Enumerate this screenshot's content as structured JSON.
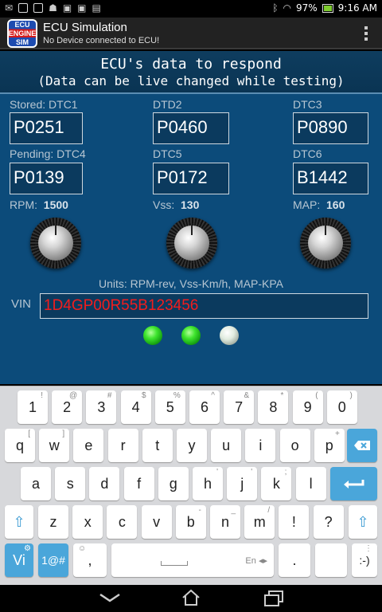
{
  "statusbar": {
    "battery": "97%",
    "time": "9:16 AM",
    "icons": [
      "gmail-icon",
      "picture-icon",
      "image-icon",
      "android-icon",
      "bag-icon",
      "bag-icon",
      "keyboard-icon",
      "bluetooth-icon",
      "wifi-icon",
      "battery-icon"
    ]
  },
  "actionbar": {
    "logo": [
      "ECU",
      "ENGINE",
      "SIM"
    ],
    "title": "ECU Simulation",
    "subtitle": "No Device connected to ECU!"
  },
  "header": {
    "line1": "ECU's data to respond",
    "line2": "(Data can be live changed while testing)"
  },
  "dtc": [
    {
      "label": "Stored: DTC1",
      "value": "P0251"
    },
    {
      "label": "DTD2",
      "value": "P0460"
    },
    {
      "label": "DTC3",
      "value": "P0890"
    },
    {
      "label": "Pending: DTC4",
      "value": "P0139"
    },
    {
      "label": "DTC5",
      "value": "P0172"
    },
    {
      "label": "DTC6",
      "value": "B1442"
    }
  ],
  "knobs": [
    {
      "label": "RPM:",
      "value": "1500"
    },
    {
      "label": "Vss:",
      "value": "130"
    },
    {
      "label": "MAP:",
      "value": "160"
    }
  ],
  "units": "Units: RPM-rev, Vss-Km/h, MAP-KPA",
  "vin": {
    "label": "VIN",
    "value": "1D4GP00R55B123456"
  },
  "leds": [
    "green",
    "green",
    "white"
  ],
  "keyboard": {
    "row1": [
      {
        "k": "1",
        "h": "!"
      },
      {
        "k": "2",
        "h": "@"
      },
      {
        "k": "3",
        "h": "#"
      },
      {
        "k": "4",
        "h": "$"
      },
      {
        "k": "5",
        "h": "%"
      },
      {
        "k": "6",
        "h": "^"
      },
      {
        "k": "7",
        "h": "&"
      },
      {
        "k": "8",
        "h": "*"
      },
      {
        "k": "9",
        "h": "("
      },
      {
        "k": "0",
        "h": ")"
      }
    ],
    "row2": [
      {
        "k": "q",
        "h": "["
      },
      {
        "k": "w",
        "h": "]"
      },
      {
        "k": "e",
        "h": ""
      },
      {
        "k": "r",
        "h": ""
      },
      {
        "k": "t",
        "h": ""
      },
      {
        "k": "y",
        "h": ""
      },
      {
        "k": "u",
        "h": ""
      },
      {
        "k": "i",
        "h": ""
      },
      {
        "k": "o",
        "h": ""
      },
      {
        "k": "p",
        "h": "+"
      }
    ],
    "row3": [
      {
        "k": "a",
        "h": ""
      },
      {
        "k": "s",
        "h": ""
      },
      {
        "k": "d",
        "h": ""
      },
      {
        "k": "f",
        "h": ""
      },
      {
        "k": "g",
        "h": ""
      },
      {
        "k": "h",
        "h": "'"
      },
      {
        "k": "j",
        "h": "'"
      },
      {
        "k": "k",
        "h": ";"
      },
      {
        "k": "l",
        "h": ""
      }
    ],
    "row4": [
      {
        "k": "z",
        "h": ""
      },
      {
        "k": "x",
        "h": ""
      },
      {
        "k": "c",
        "h": ""
      },
      {
        "k": "v",
        "h": ""
      },
      {
        "k": "b",
        "h": "-"
      },
      {
        "k": "n",
        "h": "_"
      },
      {
        "k": "m",
        "h": "/"
      },
      {
        "k": "!",
        "h": ""
      },
      {
        "k": "?",
        "h": ""
      }
    ],
    "vi": "Vi",
    "symbols": "1@#",
    "comma": ",",
    "space_lang": "En",
    "period": ".",
    "smiley": ":-)"
  },
  "colors": {
    "panel": "#0c4b7a",
    "header": "#0a3453",
    "vin_text": "#f21d1d",
    "led_green": "#3fe52e",
    "key_accent": "#4aa6da"
  }
}
